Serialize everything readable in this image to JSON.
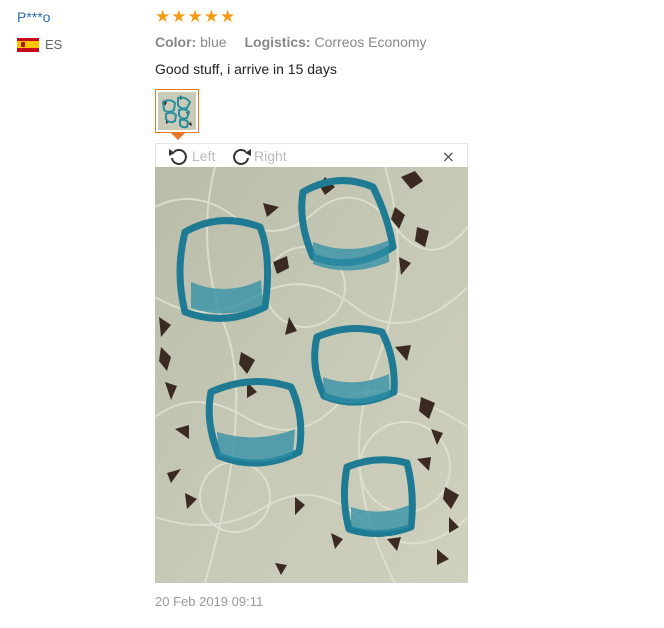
{
  "reviewer": {
    "name": "P***o",
    "country_code": "ES",
    "flag_icon": "spain-flag-icon"
  },
  "rating": {
    "stars": 5,
    "max": 5,
    "color": "#f39c12"
  },
  "attributes": [
    {
      "key": "Color:",
      "value": "blue"
    },
    {
      "key": "Logistics:",
      "value": "Correos Economy"
    }
  ],
  "review": {
    "text": "Good stuff, i arrive in 15 days"
  },
  "viewer": {
    "rotate_left_label": "Left",
    "rotate_right_label": "Right",
    "close_glyph": "×",
    "accent_color": "#e8762b"
  },
  "date": "20 Feb 2019 09:11"
}
